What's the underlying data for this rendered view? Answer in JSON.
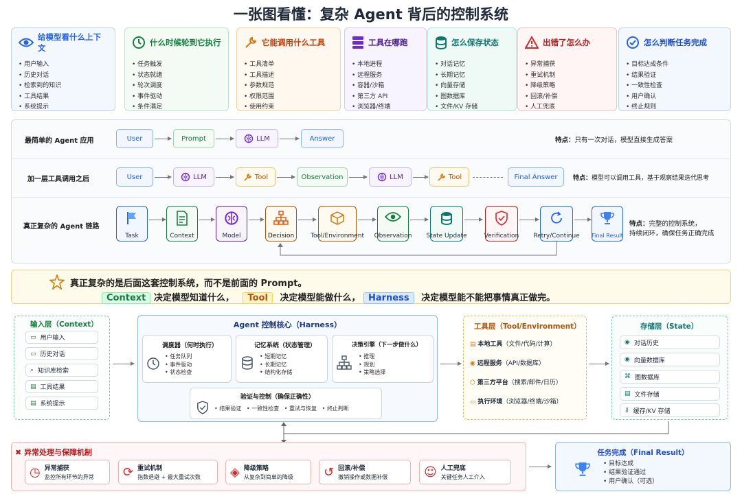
{
  "title": "一张图看懂：复杂 Agent 背后的控制系统",
  "cards": [
    {
      "title": "给模型看什么上下文",
      "color": "#2563eb",
      "icon": "eye-icon",
      "items": [
        "用户输入",
        "历史对话",
        "检索到的知识",
        "工具结果",
        "系统提示"
      ]
    },
    {
      "title": "什么时候轮到它执行",
      "color": "#15803d",
      "icon": "clock-icon",
      "items": [
        "任务触发",
        "状态就绪",
        "轮次调度",
        "事件驱动",
        "条件满足"
      ]
    },
    {
      "title": "它能调用什么工具",
      "color": "#c2410c",
      "icon": "wrench-icon",
      "items": [
        "工具清单",
        "工具描述",
        "参数规范",
        "权限范围",
        "使用约束"
      ]
    },
    {
      "title": "工具在哪跑",
      "color": "#5b21b6",
      "icon": "server-icon",
      "items": [
        "本地进程",
        "远程服务",
        "容器/沙箱",
        "第三方 API",
        "浏览器/终端"
      ]
    },
    {
      "title": "怎么保存状态",
      "color": "#0f766e",
      "icon": "database-icon",
      "items": [
        "对话记忆",
        "长期记忆",
        "向量存储",
        "图数据库",
        "文件/KV 存储"
      ]
    },
    {
      "title": "出错了怎么办",
      "color": "#b91c1c",
      "icon": "warning-icon",
      "items": [
        "异常捕获",
        "重试机制",
        "降级策略",
        "回滚/补偿",
        "人工兜底"
      ]
    },
    {
      "title": "怎么判断任务完成",
      "color": "#1d4ed8",
      "icon": "check-circle-icon",
      "items": [
        "目标达成条件",
        "结果验证",
        "一致性检查",
        "用户确认",
        "终止规则"
      ]
    }
  ],
  "flows": {
    "row1": {
      "label": "最简单的 Agent 应用",
      "nodes": [
        "User",
        "Prompt",
        "LLM",
        "Answer"
      ],
      "note_label": "特点：",
      "note": "只有一次对话，模型直接生成答案"
    },
    "row2": {
      "label": "加一层工具调用之后",
      "nodes": [
        "User",
        "LLM",
        "Tool",
        "Observation",
        "LLM",
        "Tool",
        "Final Answer"
      ],
      "note_label": "特点：",
      "note": "模型可以调用工具，基于观察结果迭代思考"
    },
    "row3": {
      "label": "真正复杂的 Agent 链路",
      "nodes": [
        "Task",
        "Context",
        "Model",
        "Decision",
        "Tool/Environment",
        "Observation",
        "State Update",
        "Verification",
        "Retry/Continue",
        "Final Result"
      ],
      "note_label": "特点：",
      "note": "完整的控制系统，",
      "note2": "持续闭环，确保任务正确完成"
    }
  },
  "banner": {
    "line1": "真正复杂的是后面这套控制系统，而不是前面的 Prompt。",
    "context": "Context",
    "context_text": "决定模型知道什么，",
    "tool": "Tool",
    "tool_text": "决定模型能做什么，",
    "harness": "Harness",
    "harness_text": "决定模型能不能把事情真正做完。"
  },
  "input_layer": {
    "title": "输入层（Context）",
    "items": [
      "用户输入",
      "历史对话",
      "知识库检索",
      "工具结果",
      "系统提示"
    ]
  },
  "core": {
    "title": "Agent 控制核心（Harness）",
    "scheduler": {
      "title": "调度器（何时执行）",
      "items": [
        "任务队列",
        "事件驱动",
        "状态检查"
      ]
    },
    "memory": {
      "title": "记忆系统（状态管理）",
      "items": [
        "短期记忆",
        "长期记忆",
        "结构化存储"
      ]
    },
    "decision": {
      "title": "决策引擎（下一步做什么）",
      "items": [
        "推理",
        "规划",
        "策略选择"
      ]
    },
    "verify": {
      "title": "验证与控制（确保正确性）",
      "items": [
        "结果验证",
        "一致性检查",
        "重试与恢复",
        "终止判断"
      ]
    }
  },
  "tool_layer": {
    "title": "工具层（Tool/Environment）",
    "items": [
      {
        "name": "本地工具",
        "desc": "（文件/代码/计算）"
      },
      {
        "name": "远程服务",
        "desc": "（API/数据库）"
      },
      {
        "name": "第三方平台",
        "desc": "（搜索/邮件/日历）"
      },
      {
        "name": "执行环境",
        "desc": "（浏览器/终端/沙箱）"
      }
    ]
  },
  "storage_layer": {
    "title": "存储层（State）",
    "items": [
      "对话历史",
      "向量数据库",
      "图数据库",
      "文件存储",
      "缓存/KV 存储"
    ]
  },
  "exception": {
    "title": "异常处理与保障机制",
    "items": [
      {
        "name": "异常捕获",
        "desc": "监控所有环节的异常"
      },
      {
        "name": "重试机制",
        "desc": "指数退避 + 最大重试次数"
      },
      {
        "name": "降级策略",
        "desc": "从复杂到简单的降级"
      },
      {
        "name": "回滚/补偿",
        "desc": "撤销操作或数据补偿"
      },
      {
        "name": "人工兜底",
        "desc": "关键任务人工介入"
      }
    ]
  },
  "final": {
    "title": "任务完成（Final Result）",
    "items": [
      "目标达成",
      "结果验证通过",
      "用户确认（可选）"
    ]
  }
}
